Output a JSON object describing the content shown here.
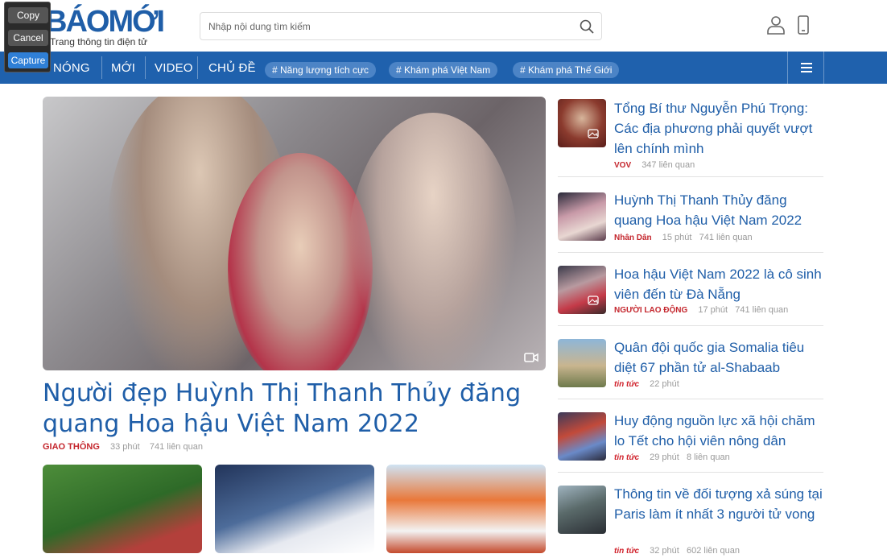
{
  "header": {
    "brand_main": "BÁOMỚI",
    "brand_tagline": "Trang thông tin điện tử",
    "search_placeholder": "Nhập nội dung tìm kiếm"
  },
  "capture_toolbar": {
    "copy_label": "Copy",
    "cancel_label": "Cancel",
    "capture_label": "Capture"
  },
  "nav": {
    "items": [
      "NÓNG",
      "MỚI",
      "VIDEO",
      "CHỦ ĐỀ"
    ],
    "tags": [
      "# Năng lượng tích cực",
      "# Khám phá Việt Nam",
      "# Khám phá Thế Giới"
    ]
  },
  "featured": {
    "title": "Người đẹp Huỳnh Thị Thanh Thủy đăng quang Hoa hậu Việt Nam 2022",
    "source": "GIAO THÔNG",
    "time": "33 phút",
    "related": "741 liên quan"
  },
  "side_articles": [
    {
      "title": "Tổng Bí thư Nguyễn Phú Trọng: Các địa phương phải quyết vượt lên chính mình",
      "source": "VOV",
      "time": "",
      "related": "347 liên quan"
    },
    {
      "title": "Huỳnh Thị Thanh Thủy đăng quang Hoa hậu Việt Nam 2022",
      "source": "Nhân Dân",
      "time": "15 phút",
      "related": "741 liên quan"
    },
    {
      "title": "Hoa hậu Việt Nam 2022 là cô sinh viên đến từ Đà Nẵng",
      "source": "NGƯỜI LAO ĐỘNG",
      "time": "17 phút",
      "related": "741 liên quan"
    },
    {
      "title": "Quân đội quốc gia Somalia tiêu diệt 67 phần tử al-Shabaab",
      "source": "tin tức",
      "time": "22 phút",
      "related": ""
    },
    {
      "title": "Huy động nguồn lực xã hội chăm lo Tết cho hội viên nông dân",
      "source": "tin tức",
      "time": "29 phút",
      "related": "8 liên quan"
    },
    {
      "title": "Thông tin về đối tượng xả súng tại Paris làm ít nhất 3 người tử vong",
      "source": "tin tức",
      "time": "32 phút",
      "related": "602 liên quan"
    }
  ],
  "colors": {
    "brand_blue": "#1f61ad",
    "tag_bg": "#4c84c6",
    "title_blue": "#1f5ea8",
    "accent_red": "#e03c31"
  }
}
